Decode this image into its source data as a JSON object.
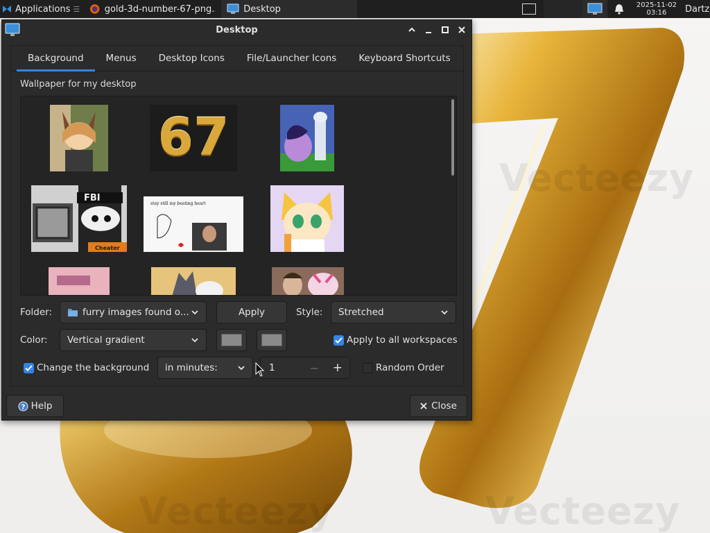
{
  "panel": {
    "applications_label": "Applications",
    "tasks": [
      {
        "label": "gold-3d-number-67-png..."
      },
      {
        "label": "Desktop"
      }
    ],
    "clock": {
      "date": "2025-11-02",
      "time": "03:16"
    },
    "user": "Dartz"
  },
  "window": {
    "title": "Desktop",
    "tabs": [
      {
        "label": "Background"
      },
      {
        "label": "Menus"
      },
      {
        "label": "Desktop Icons"
      },
      {
        "label": "File/Launcher Icons"
      },
      {
        "label": "Keyboard Shortcuts"
      }
    ],
    "active_tab": "Background",
    "wallpaper_label": "Wallpaper for my desktop",
    "thumb_text": {
      "fbi": "FBI",
      "cheater": "Cheater",
      "heart": "stay still my beating heart",
      "big67": "67"
    },
    "folder_label": "Folder:",
    "folder_value": "furry images found o...",
    "apply_label": "Apply",
    "style_label": "Style:",
    "style_value": "Stretched",
    "color_label": "Color:",
    "color_value": "Vertical gradient",
    "apply_all_label": "Apply to all workspaces",
    "apply_all_checked": true,
    "change_bg_label": "Change the background",
    "change_bg_checked": true,
    "interval_unit": "in minutes:",
    "interval_value": "1",
    "random_label": "Random Order",
    "random_checked": false,
    "help_label": "Help",
    "close_label": "Close"
  },
  "colors": {
    "accent": "#3584e4",
    "window_bg": "#2b2b2b",
    "panel_bg": "#1f1f1f"
  },
  "background_watermark": "Vecteezy"
}
